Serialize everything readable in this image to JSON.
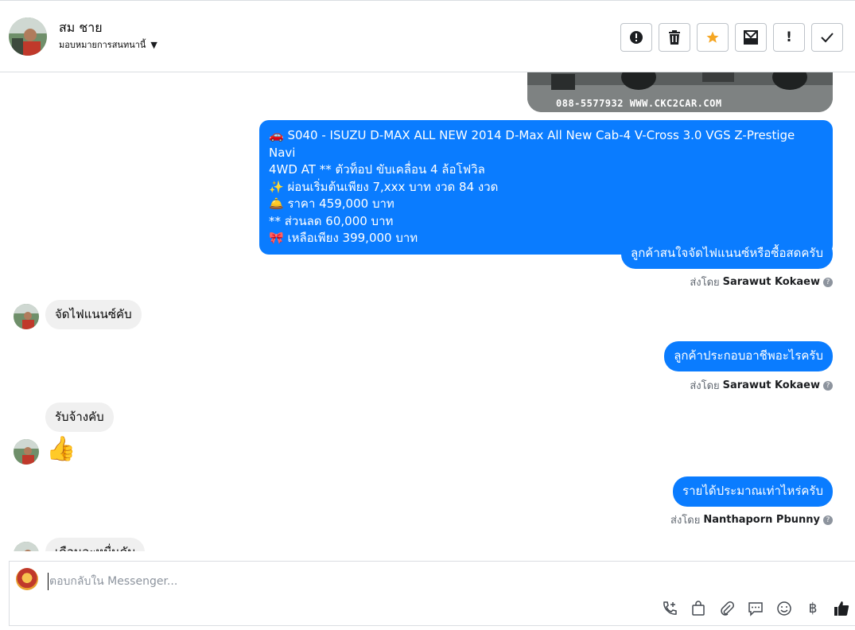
{
  "header": {
    "contact_name": "สม ชาย",
    "assign_label": "มอบหมายการสนทนานี้",
    "actions": [
      {
        "name": "report-button",
        "glyph": "!"
      },
      {
        "name": "delete-button",
        "glyph": "🗑"
      },
      {
        "name": "star-button",
        "glyph": "★"
      },
      {
        "name": "mark-unread-button",
        "glyph": "✉"
      },
      {
        "name": "follow-up-button",
        "glyph": "!"
      },
      {
        "name": "done-button",
        "glyph": "✓"
      }
    ]
  },
  "image_watermark": "088-5577932 WWW.CKC2CAR.COM",
  "messages": {
    "car_listing": {
      "line1": "🚗 S040 - ISUZU D-MAX ALL NEW 2014 D-Max All New Cab-4 V-Cross 3.0 VGS Z-Prestige Navi",
      "line2": "4WD AT  ** ตัวท็อป ขับเคลื่อน 4 ล้อโฟวิล",
      "line3": "✨ ผ่อนเริ่มต้นเพียง 7,xxx บาท งวด 84 งวด",
      "line4": "🛎️ ราคา 459,000 บาท",
      "line5": "** ส่วนลด 60,000 บาท",
      "line6": "🎀 เหลือเพียง 399,000 บาท"
    },
    "out1": "ลูกค้าสนใจจัดไฟแนนซ์หรือซื้อสดครับ",
    "sent_by_label": "ส่งโดย",
    "sender1": "Sarawut Kokaew",
    "in1": "จัดไฟแนนซ์คับ",
    "out2": "ลูกค้าประกอบอาชีพอะไรครับ",
    "sender2": "Sarawut Kokaew",
    "in2": "รับจ้างคับ",
    "in_emoji": "👍",
    "out3": "รายได้ประมาณเท่าไหร่ครับ",
    "sender3": "Nanthaporn Pbunny",
    "in3_partial": "เดือนละหมื่นคับ"
  },
  "composer": {
    "placeholder": "ตอบกลับใน Messenger..."
  }
}
